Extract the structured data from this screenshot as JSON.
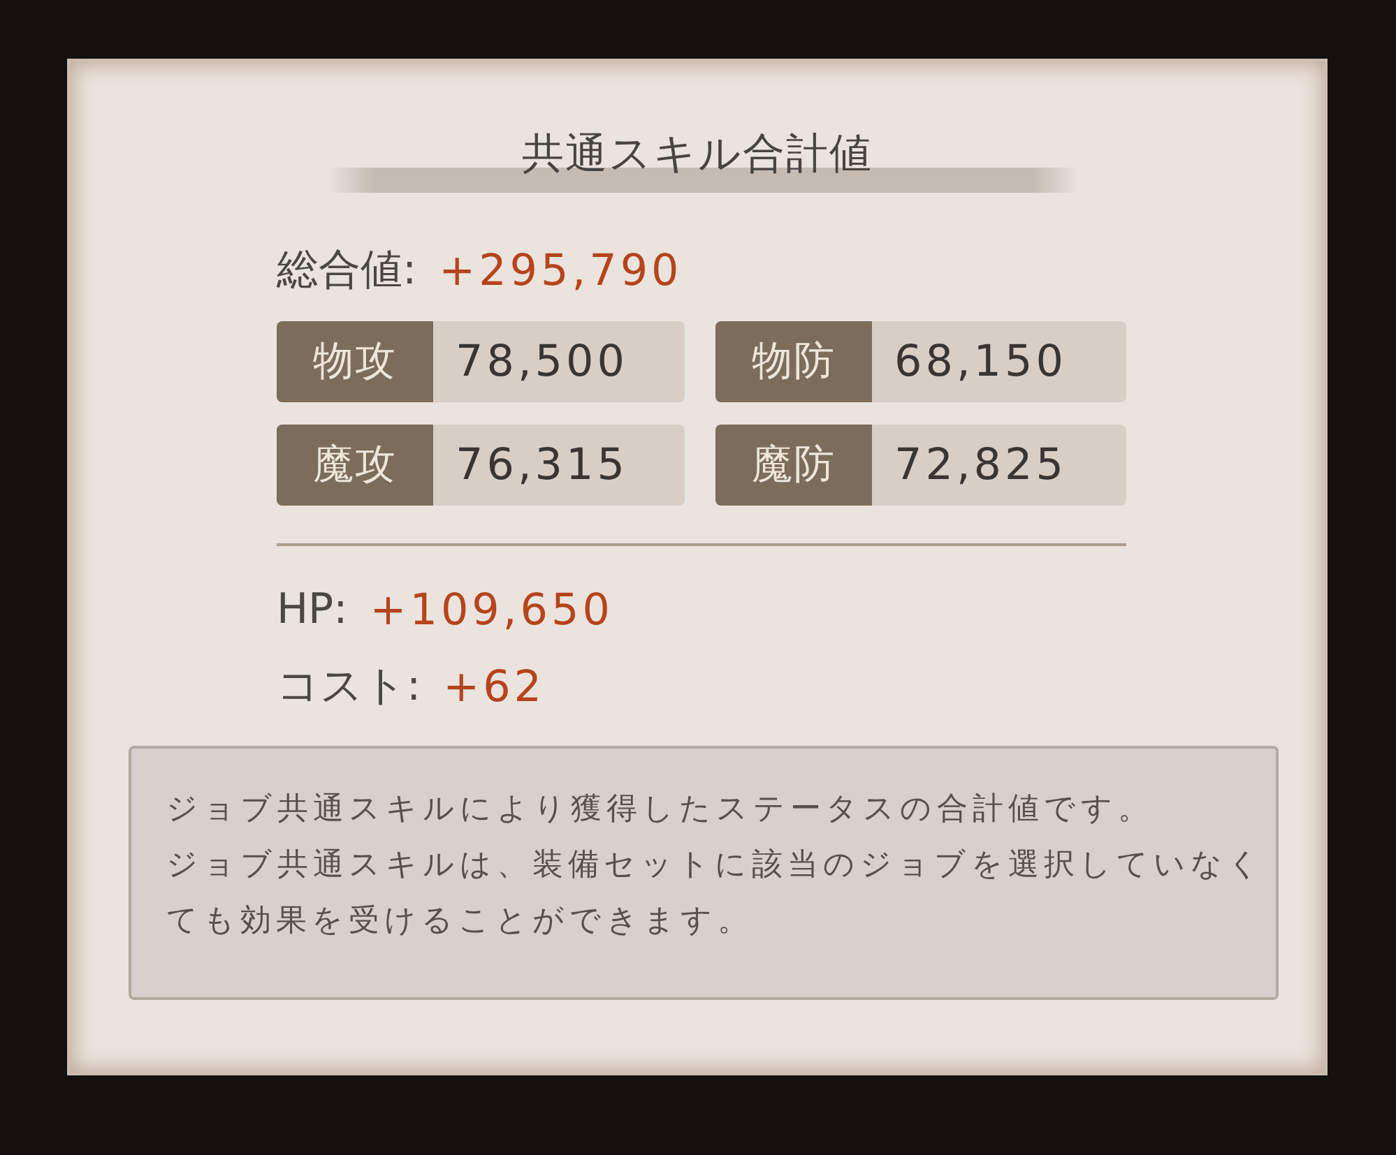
{
  "title": "共通スキル合計値",
  "total": {
    "label": "総合値:",
    "value": "+295,790"
  },
  "stats": [
    {
      "label": "物攻",
      "value": "78,500"
    },
    {
      "label": "物防",
      "value": "68,150"
    },
    {
      "label": "魔攻",
      "value": "76,315"
    },
    {
      "label": "魔防",
      "value": "72,825"
    }
  ],
  "extras": [
    {
      "label": "HP:",
      "value": "+109,650"
    },
    {
      "label": "コスト:",
      "value": "+62"
    }
  ],
  "note": {
    "paragraphs": [
      "ジョブ共通スキルにより獲得したステータスの合計値です。",
      "ジョブ共通スキルは、装備セットに該当のジョブを選択していなくても効果を受けることができます。"
    ]
  }
}
